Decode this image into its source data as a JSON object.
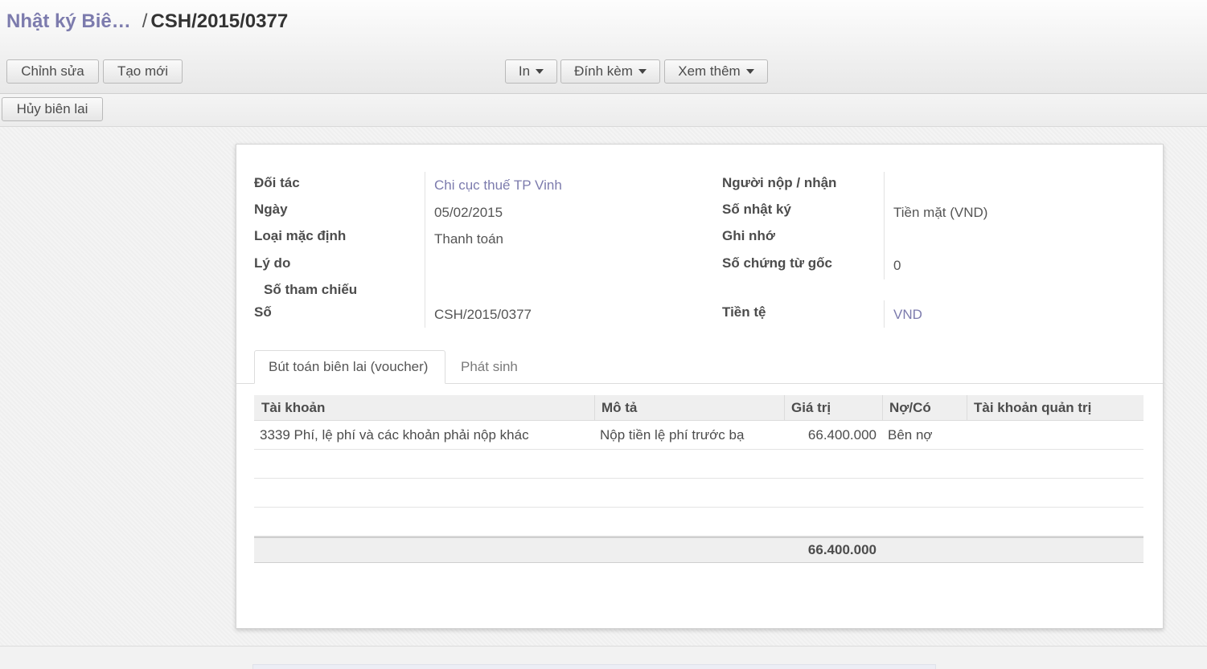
{
  "breadcrumb": {
    "parent": "Nhật ký Biê…",
    "separator": "/",
    "current": "CSH/2015/0377"
  },
  "toolbar": {
    "edit_label": "Chỉnh sửa",
    "create_label": "Tạo mới",
    "print_label": "In",
    "attach_label": "Đính kèm",
    "more_label": "Xem thêm"
  },
  "statusbar": {
    "cancel_label": "Hủy biên lai"
  },
  "form": {
    "left": [
      {
        "label": "Đối tác",
        "value": "Chi cục thuế TP Vinh"
      },
      {
        "label": "Ngày",
        "value": "05/02/2015"
      },
      {
        "label": "Loại mặc định",
        "value": "Thanh toán"
      },
      {
        "label": "Lý do",
        "value": ""
      },
      {
        "label": "Số tham chiếu",
        "value": ""
      },
      {
        "label": "Số",
        "value": "CSH/2015/0377"
      }
    ],
    "right": [
      {
        "label": "Người nộp / nhận",
        "value": ""
      },
      {
        "label": "Số nhật ký",
        "value": "Tiền mặt (VND)"
      },
      {
        "label": "Ghi nhớ",
        "value": ""
      },
      {
        "label": "Số chứng từ gốc",
        "value": "0"
      },
      {
        "label": "Tiền tệ",
        "value": "VND"
      }
    ]
  },
  "tabs": [
    {
      "label": "Bút toán biên lai (voucher)",
      "active": true
    },
    {
      "label": "Phát sinh",
      "active": false
    }
  ],
  "table": {
    "columns": [
      "Tài khoản",
      "Mô tả",
      "Giá trị",
      "Nợ/Có",
      "Tài khoản quản trị"
    ],
    "rows": [
      {
        "account": "3339 Phí, lệ phí và các khoản phải nộp khác",
        "description": "Nộp tiền lệ phí trước bạ",
        "amount": "66.400.000",
        "side": "Bên nợ",
        "analytic": ""
      }
    ],
    "total": "66.400.000"
  }
}
